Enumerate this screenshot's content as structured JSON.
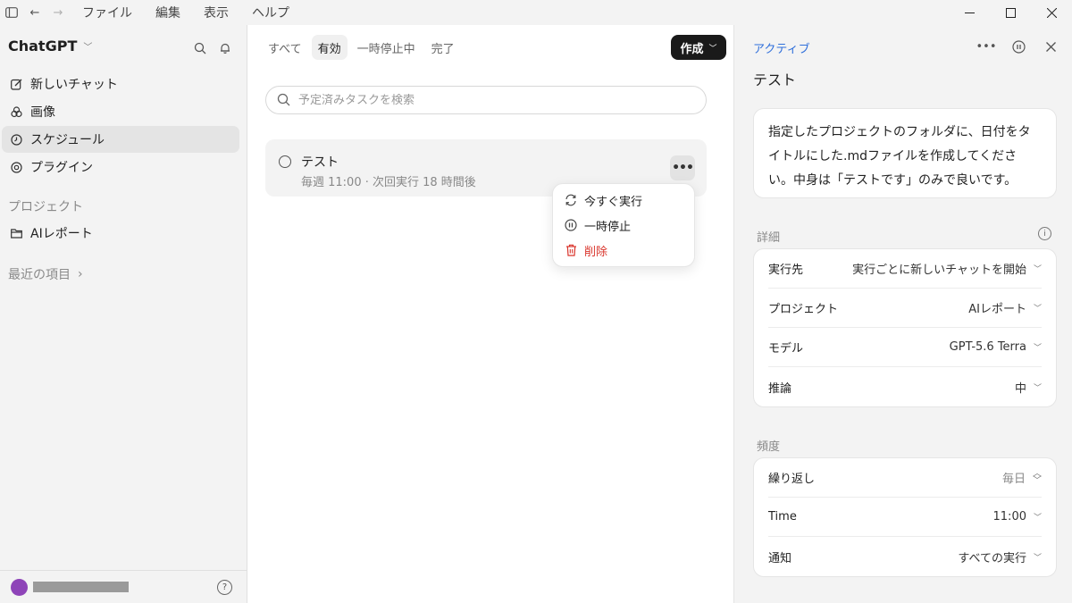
{
  "menubar": {
    "items": [
      "ファイル",
      "編集",
      "表示",
      "ヘルプ"
    ]
  },
  "sidebar": {
    "brand": "ChatGPT",
    "nav": [
      {
        "label": "新しいチャット",
        "icon": "edit-icon"
      },
      {
        "label": "画像",
        "icon": "image-icon"
      },
      {
        "label": "スケジュール",
        "icon": "clock-icon"
      },
      {
        "label": "プラグイン",
        "icon": "plugin-icon"
      }
    ],
    "projects_label": "プロジェクト",
    "project_item": "AIレポート",
    "recent_label": "最近の項目"
  },
  "center": {
    "tabs": [
      "すべて",
      "有効",
      "一時停止中",
      "完了"
    ],
    "selected_tab": "有効",
    "create_label": "作成",
    "search_placeholder": "予定済みタスクを検索",
    "task": {
      "title": "テスト",
      "subtitle": "毎週 11:00 · 次回実行 18 時間後"
    },
    "context_menu": [
      {
        "label": "今すぐ実行",
        "icon": "refresh-icon"
      },
      {
        "label": "一時停止",
        "icon": "pause-icon"
      },
      {
        "label": "削除",
        "icon": "trash-icon"
      }
    ]
  },
  "detail": {
    "status": "アクティブ",
    "title": "テスト",
    "prompt": "指定したプロジェクトのフォルダに、日付をタイトルにした.mdファイルを作成してください。中身は「テストです」のみで良いです。",
    "details_label": "詳細",
    "details": [
      {
        "label": "実行先",
        "value": "実行ごとに新しいチャットを開始"
      },
      {
        "label": "プロジェクト",
        "value": "AIレポート"
      },
      {
        "label": "モデル",
        "value": "GPT-5.6 Terra"
      },
      {
        "label": "推論",
        "value": "中"
      }
    ],
    "frequency_label": "頻度",
    "frequency": [
      {
        "label": "繰り返し",
        "value": "毎日"
      },
      {
        "label": "Time",
        "value": "11:00"
      },
      {
        "label": "通知",
        "value": "すべての実行"
      }
    ]
  },
  "colors": {
    "accent": "#2f6fdb",
    "danger": "#d9342b",
    "create_button": "#1a1a1a",
    "avatar": "#8e44b8"
  }
}
